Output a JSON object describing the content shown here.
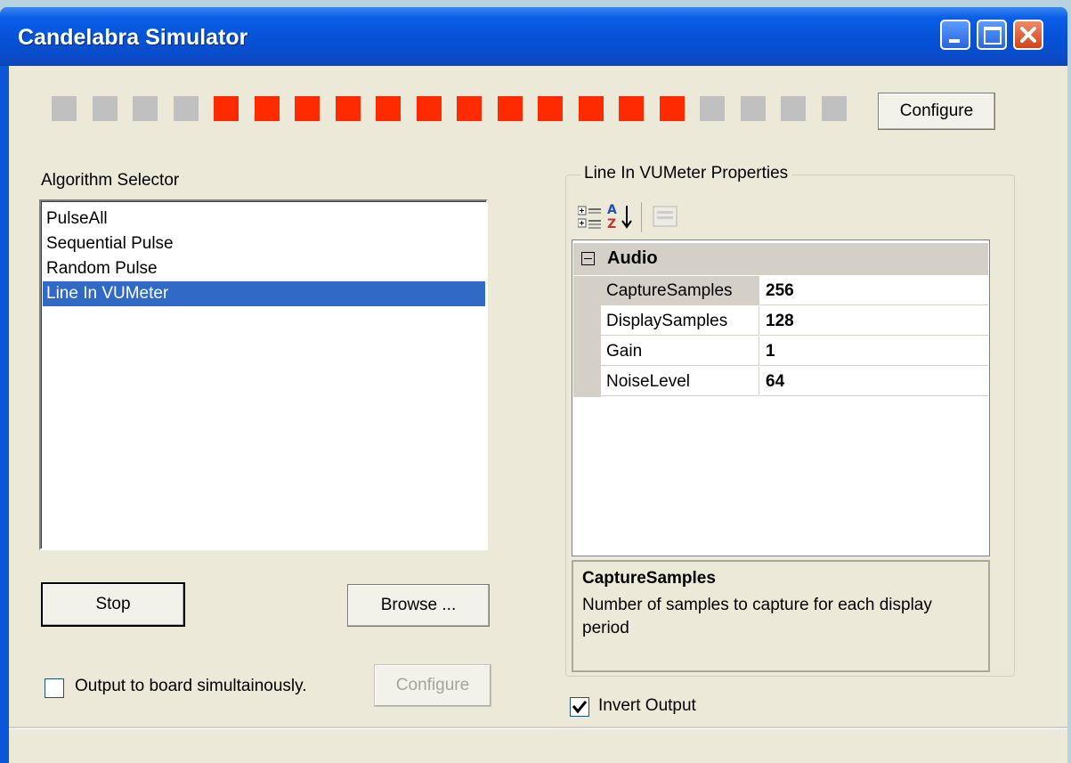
{
  "window": {
    "title": "Candelabra Simulator"
  },
  "leds": [
    {
      "state": "off"
    },
    {
      "state": "off"
    },
    {
      "state": "off"
    },
    {
      "state": "off"
    },
    {
      "state": "on"
    },
    {
      "state": "on"
    },
    {
      "state": "on"
    },
    {
      "state": "on"
    },
    {
      "state": "on"
    },
    {
      "state": "on"
    },
    {
      "state": "on"
    },
    {
      "state": "on"
    },
    {
      "state": "on"
    },
    {
      "state": "on"
    },
    {
      "state": "on"
    },
    {
      "state": "on"
    },
    {
      "state": "off"
    },
    {
      "state": "off"
    },
    {
      "state": "off"
    },
    {
      "state": "off"
    }
  ],
  "colors": {
    "led_on": "#ff2a00",
    "led_off": "#c0c0c0",
    "selection": "#3169c6"
  },
  "top_configure_label": "Configure",
  "algorithm": {
    "label": "Algorithm Selector",
    "items": [
      "PulseAll",
      "Sequential Pulse",
      "Random Pulse",
      "Line In VUMeter"
    ],
    "selected": "Line In VUMeter"
  },
  "controls": {
    "stop_label": "Stop",
    "browse_label": "Browse ...",
    "output_checkbox_label": "Output to board simultainously.",
    "output_checked": false,
    "bottom_configure_label": "Configure"
  },
  "properties": {
    "group_label": "Line In VUMeter Properties",
    "category": "Audio",
    "rows": [
      {
        "name": "CaptureSamples",
        "value": "256"
      },
      {
        "name": "DisplaySamples",
        "value": "128"
      },
      {
        "name": "Gain",
        "value": "1"
      },
      {
        "name": "NoiseLevel",
        "value": "64"
      }
    ],
    "help_title": "CaptureSamples",
    "help_desc": "Number of samples to capture for each display period"
  },
  "invert": {
    "label": "Invert Output",
    "checked": true
  }
}
